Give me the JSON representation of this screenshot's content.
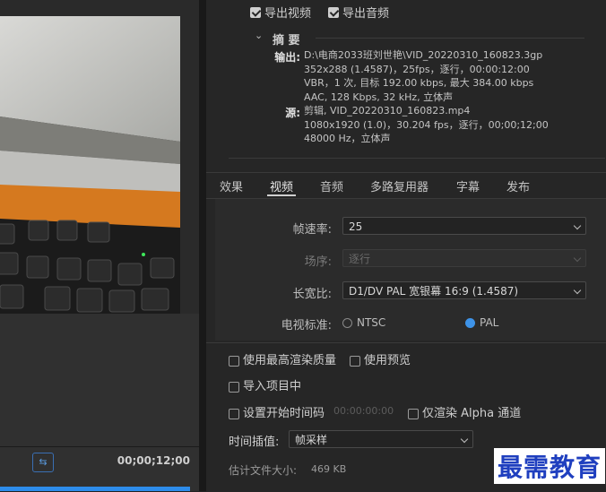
{
  "export": {
    "video_label": "导出视频",
    "audio_label": "导出音频",
    "video_checked": true,
    "audio_checked": true
  },
  "summary": {
    "title": "摘 要",
    "output_label": "输出:",
    "output_lines": [
      "D:\\电商2033班刘世艳\\VID_20220310_160823.3gp",
      "352x288 (1.4587)，25fps，逐行，00:00:12:00",
      "VBR，1 次, 目标 192.00 kbps, 最大 384.00 kbps",
      "AAC, 128 Kbps, 32  kHz, 立体声"
    ],
    "source_label": "源:",
    "source_lines": [
      "剪辑, VID_20220310_160823.mp4",
      "1080x1920 (1.0)，30.204 fps，逐行，00;00;12;00",
      "48000 Hz，立体声"
    ]
  },
  "tabs": [
    {
      "label": "效果"
    },
    {
      "label": "视频"
    },
    {
      "label": "音频"
    },
    {
      "label": "多路复用器"
    },
    {
      "label": "字幕"
    },
    {
      "label": "发布"
    }
  ],
  "settings": {
    "frame_rate_label": "帧速率:",
    "frame_rate_value": "25",
    "field_order_label": "场序:",
    "field_order_value": "逐行",
    "aspect_label": "长宽比:",
    "aspect_value": "D1/DV PAL 宽银幕 16:9 (1.4587)",
    "tv_standard_label": "电视标准:",
    "ntsc_label": "NTSC",
    "pal_label": "PAL"
  },
  "options": {
    "max_quality": "使用最高渲染质量",
    "use_preview": "使用预览",
    "import_project": "导入项目中",
    "set_start_timecode": "设置开始时间码",
    "start_timecode_value": "00:00:00:00",
    "alpha_only": "仅渲染 Alpha 通道",
    "interpolation_label": "时间插值:",
    "interpolation_value": "帧采样",
    "file_size_label": "估计文件大小:",
    "file_size_value": "469 KB"
  },
  "preview": {
    "timecode": "00;00;12;00"
  },
  "watermark": "最需教育",
  "colors": {
    "accent": "#2d8ceb",
    "background": "#232323"
  }
}
